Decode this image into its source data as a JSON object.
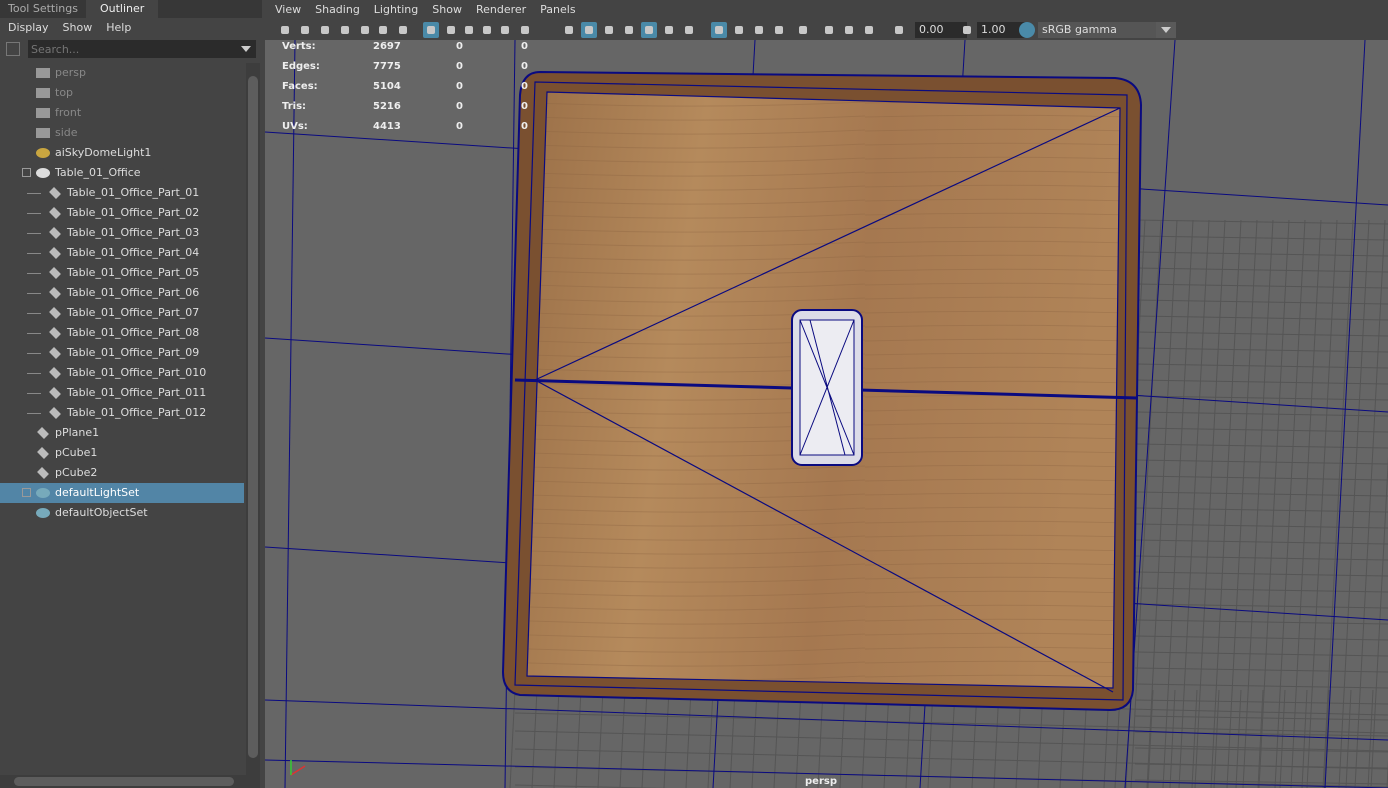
{
  "left_panel": {
    "tabs": [
      {
        "label": "Tool Settings",
        "active": false
      },
      {
        "label": "Outliner",
        "active": true
      }
    ],
    "menu": [
      "Display",
      "Show",
      "Help"
    ],
    "search": {
      "placeholder": "Search...",
      "value": ""
    },
    "items": [
      {
        "label": "persp",
        "icon": "camera-icon",
        "dim": true,
        "level": 1
      },
      {
        "label": "top",
        "icon": "camera-icon",
        "dim": true,
        "level": 1
      },
      {
        "label": "front",
        "icon": "camera-icon",
        "dim": true,
        "level": 1
      },
      {
        "label": "side",
        "icon": "camera-icon",
        "dim": true,
        "level": 1
      },
      {
        "label": "aiSkyDomeLight1",
        "icon": "skydome-light-icon",
        "level": 1
      },
      {
        "label": "Table_01_Office",
        "icon": "group-icon",
        "level": 1,
        "expanded": true
      },
      {
        "label": "Table_01_Office_Part_01",
        "icon": "mesh-icon",
        "level": 2
      },
      {
        "label": "Table_01_Office_Part_02",
        "icon": "mesh-icon",
        "level": 2
      },
      {
        "label": "Table_01_Office_Part_03",
        "icon": "mesh-icon",
        "level": 2
      },
      {
        "label": "Table_01_Office_Part_04",
        "icon": "mesh-icon",
        "level": 2
      },
      {
        "label": "Table_01_Office_Part_05",
        "icon": "mesh-icon",
        "level": 2
      },
      {
        "label": "Table_01_Office_Part_06",
        "icon": "mesh-icon",
        "level": 2
      },
      {
        "label": "Table_01_Office_Part_07",
        "icon": "mesh-icon",
        "level": 2
      },
      {
        "label": "Table_01_Office_Part_08",
        "icon": "mesh-icon",
        "level": 2
      },
      {
        "label": "Table_01_Office_Part_09",
        "icon": "mesh-icon",
        "level": 2
      },
      {
        "label": "Table_01_Office_Part_010",
        "icon": "mesh-icon",
        "level": 2
      },
      {
        "label": "Table_01_Office_Part_011",
        "icon": "mesh-icon",
        "level": 2
      },
      {
        "label": "Table_01_Office_Part_012",
        "icon": "mesh-icon",
        "level": 2
      },
      {
        "label": "pPlane1",
        "icon": "mesh-icon",
        "level": 1
      },
      {
        "label": "pCube1",
        "icon": "mesh-icon",
        "level": 1
      },
      {
        "label": "pCube2",
        "icon": "mesh-icon",
        "level": 1
      },
      {
        "label": "defaultLightSet",
        "icon": "set-icon",
        "level": 1,
        "selected": true,
        "expandable": true
      },
      {
        "label": "defaultObjectSet",
        "icon": "set-icon",
        "level": 1
      }
    ]
  },
  "viewport": {
    "menu": [
      "View",
      "Shading",
      "Lighting",
      "Show",
      "Renderer",
      "Panels"
    ],
    "exposure": "0.00",
    "gamma": "1.00",
    "color_space": "sRGB gamma",
    "camera_label": "persp",
    "hud": [
      {
        "label": "Verts:",
        "values": [
          "2697",
          "0",
          "0"
        ]
      },
      {
        "label": "Edges:",
        "values": [
          "7775",
          "0",
          "0"
        ]
      },
      {
        "label": "Faces:",
        "values": [
          "5104",
          "0",
          "0"
        ]
      },
      {
        "label": "Tris:",
        "values": [
          "5216",
          "0",
          "0"
        ]
      },
      {
        "label": "UVs:",
        "values": [
          "4413",
          "0",
          "0"
        ]
      }
    ],
    "colors": {
      "wireframe": "#0a0a80",
      "wood": "#a87a50",
      "selection": "#5285a6",
      "accent": "#5bc0d8"
    }
  }
}
